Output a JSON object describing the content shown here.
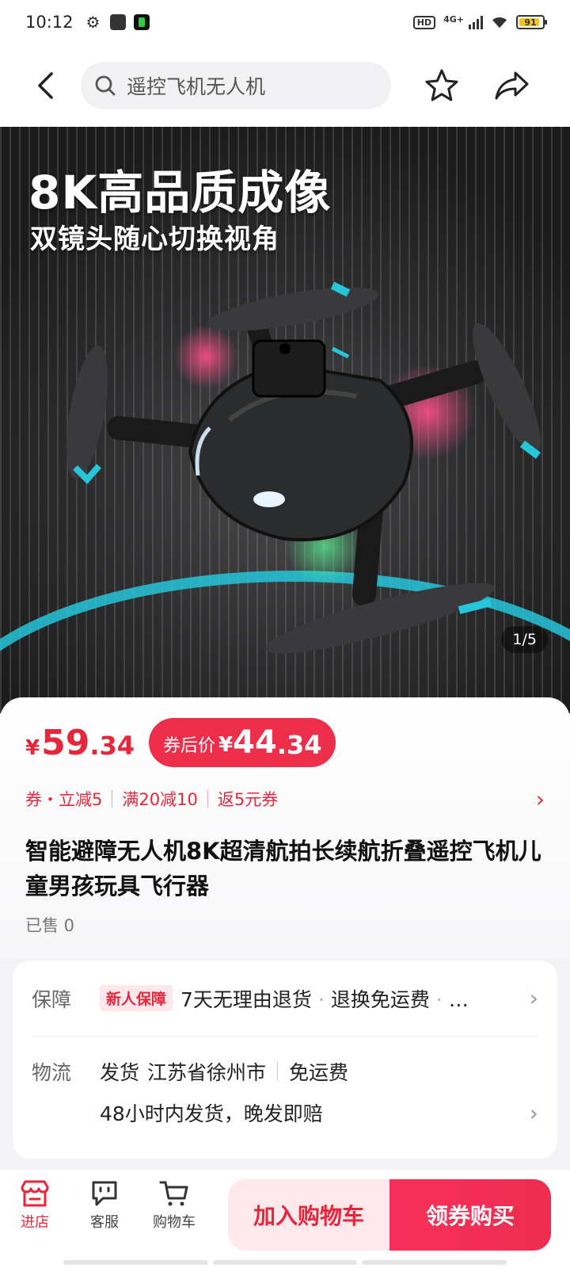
{
  "status_bar": {
    "time": "10:12",
    "network": "4G+",
    "battery": "91",
    "battery_level": 0.91
  },
  "header": {
    "search_text": "遥控飞机无人机",
    "back_icon": "back-arrow-icon",
    "favorite_icon": "star-icon",
    "share_icon": "share-icon"
  },
  "hero": {
    "headline": "8K高品质成像",
    "subline": "双镜头随心切换视角",
    "counter": "1/5"
  },
  "price": {
    "currency": "¥",
    "original_int": "59",
    "original_dec": ".34",
    "coupon_label": "券后价",
    "coupon_int": "44",
    "coupon_dec": ".34"
  },
  "promos": [
    "券・立减5",
    "满20减10",
    "返5元券"
  ],
  "product": {
    "title": "智能避障无人机8K超清航拍长续航折叠遥控飞机儿童男孩玩具飞行器",
    "sold": "已售 0"
  },
  "service": {
    "guarantee_label": "保障",
    "guarantee_badge": "新人保障",
    "guarantee_items": [
      "7天无理由退货",
      "退换免运费",
      "…"
    ],
    "logistics_label": "物流",
    "ship_prefix": "发货",
    "ship_origin": "江苏省徐州市",
    "ship_fee": "免运费",
    "ship_promise": "48小时内发货，晚发即赔"
  },
  "bottom_bar": {
    "store": "进店",
    "service": "客服",
    "cart": "购物车",
    "add_cart": "加入购物车",
    "buy_now": "领券购买"
  },
  "colors": {
    "accent": "#e8263b",
    "cta": "#ef2d50",
    "cta_light": "#ffe9ec",
    "hero_cyan": "#26c6da"
  }
}
